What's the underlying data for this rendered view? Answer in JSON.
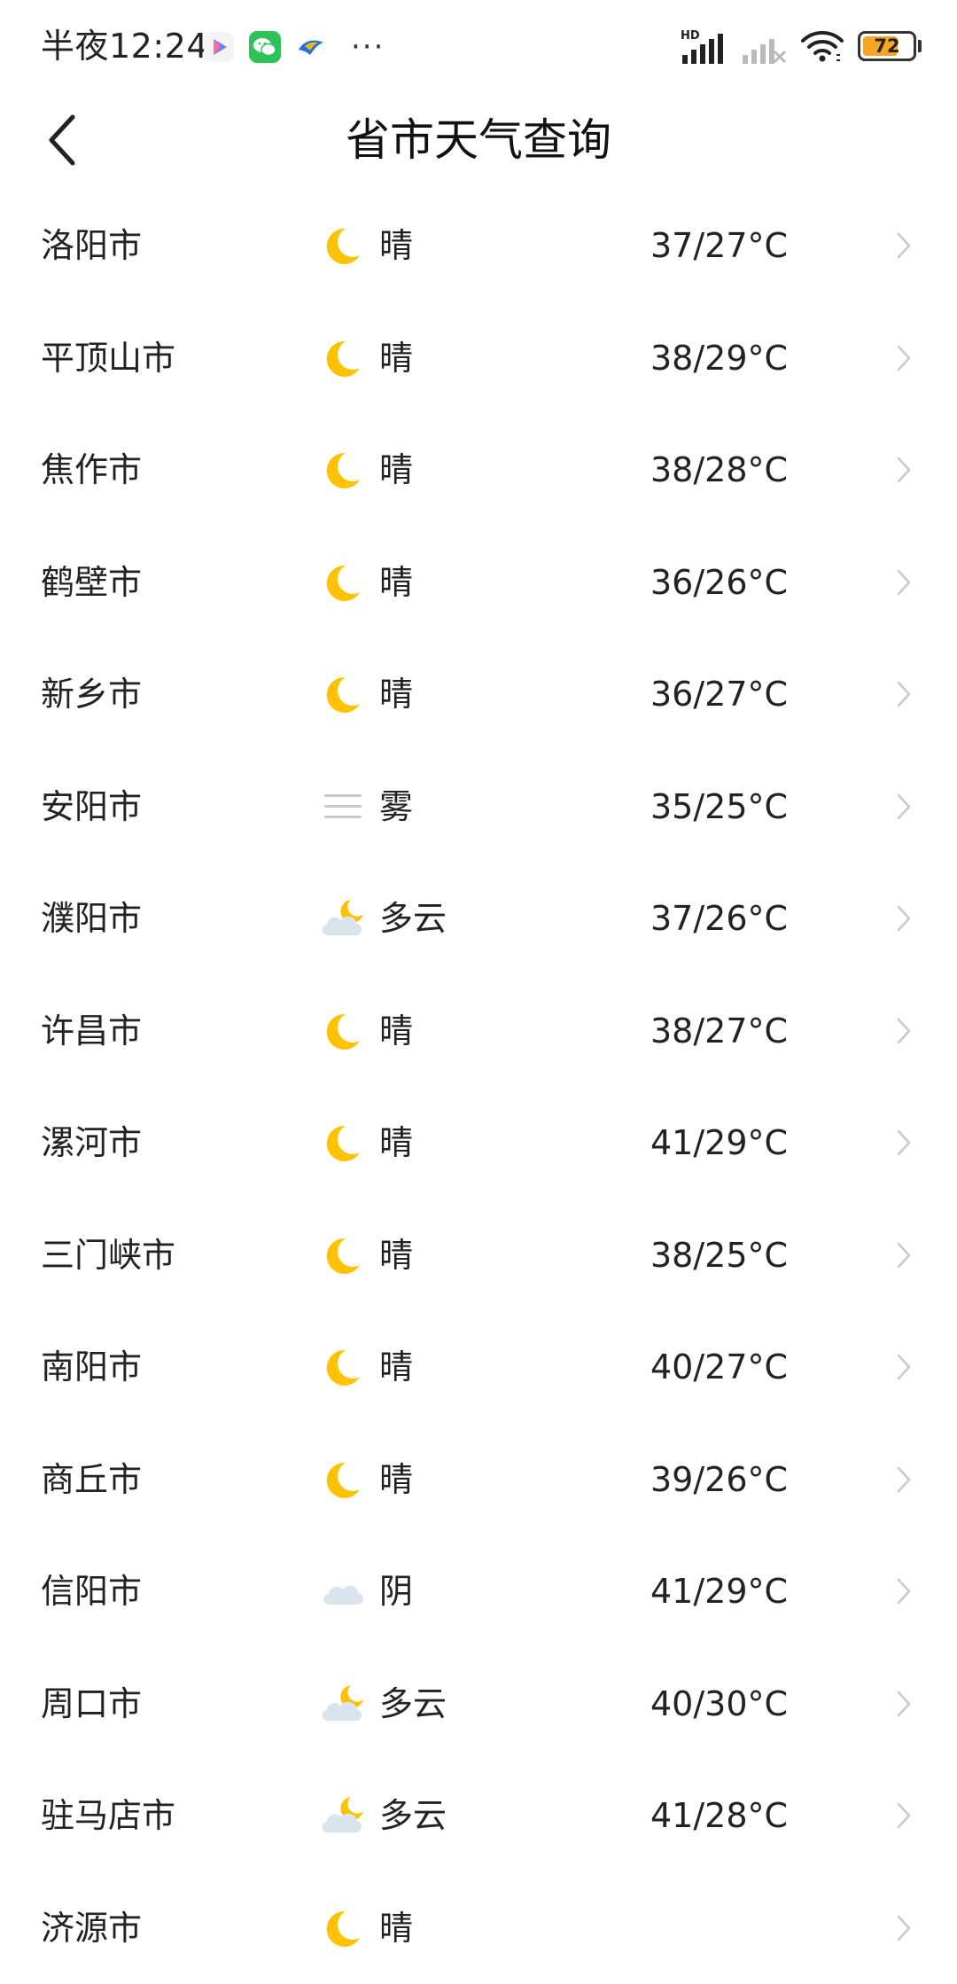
{
  "status_bar": {
    "time": "半夜12:24",
    "battery": 72,
    "battery_label": "72",
    "network_label": "HD",
    "app_icons": [
      "video-app-icon",
      "wechat-icon",
      "bird-app-icon"
    ],
    "more_label": "···"
  },
  "header": {
    "title": "省市天气查询"
  },
  "colors": {
    "moon": "#FFC200",
    "cloud": "#D9E4EE",
    "fog": "#C8C8C8",
    "chevron": "#C9C9C9",
    "battery": "#F5A623"
  },
  "cities": [
    {
      "name": "洛阳市",
      "weather": "晴",
      "icon": "moon-icon",
      "temp": "37/27°C"
    },
    {
      "name": "平顶山市",
      "weather": "晴",
      "icon": "moon-icon",
      "temp": "38/29°C"
    },
    {
      "name": "焦作市",
      "weather": "晴",
      "icon": "moon-icon",
      "temp": "38/28°C"
    },
    {
      "name": "鹤壁市",
      "weather": "晴",
      "icon": "moon-icon",
      "temp": "36/26°C"
    },
    {
      "name": "新乡市",
      "weather": "晴",
      "icon": "moon-icon",
      "temp": "36/27°C"
    },
    {
      "name": "安阳市",
      "weather": "雾",
      "icon": "fog-icon",
      "temp": "35/25°C"
    },
    {
      "name": "濮阳市",
      "weather": "多云",
      "icon": "partly-cloudy-night-icon",
      "temp": "37/26°C"
    },
    {
      "name": "许昌市",
      "weather": "晴",
      "icon": "moon-icon",
      "temp": "38/27°C"
    },
    {
      "name": "漯河市",
      "weather": "晴",
      "icon": "moon-icon",
      "temp": "41/29°C"
    },
    {
      "name": "三门峡市",
      "weather": "晴",
      "icon": "moon-icon",
      "temp": "38/25°C"
    },
    {
      "name": "南阳市",
      "weather": "晴",
      "icon": "moon-icon",
      "temp": "40/27°C"
    },
    {
      "name": "商丘市",
      "weather": "晴",
      "icon": "moon-icon",
      "temp": "39/26°C"
    },
    {
      "name": "信阳市",
      "weather": "阴",
      "icon": "cloud-icon",
      "temp": "41/29°C"
    },
    {
      "name": "周口市",
      "weather": "多云",
      "icon": "partly-cloudy-night-icon",
      "temp": "40/30°C"
    },
    {
      "name": "驻马店市",
      "weather": "多云",
      "icon": "partly-cloudy-night-icon",
      "temp": "41/28°C"
    },
    {
      "name": "济源市",
      "weather": "晴",
      "icon": "moon-icon",
      "temp": ""
    }
  ]
}
